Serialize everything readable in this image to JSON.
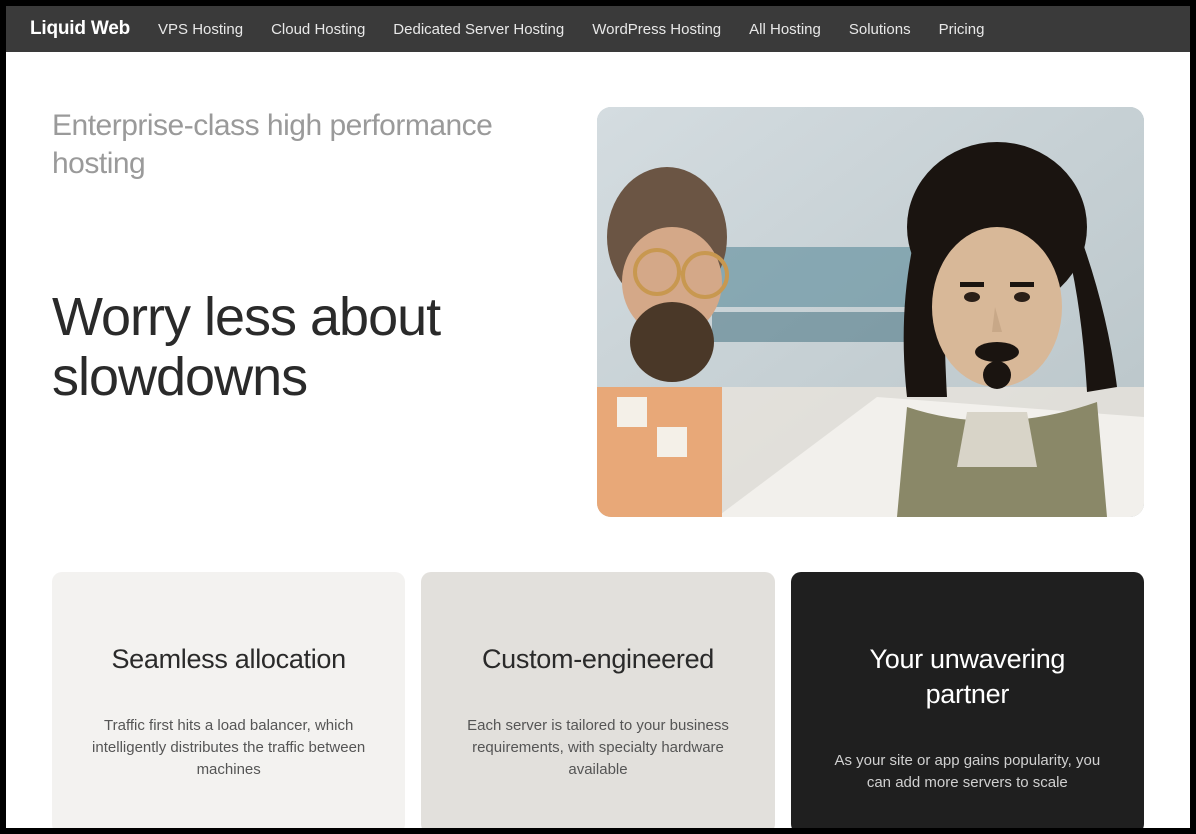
{
  "nav": {
    "brand": "Liquid Web",
    "links": [
      "VPS Hosting",
      "Cloud Hosting",
      "Dedicated Server Hosting",
      "WordPress Hosting",
      "All Hosting",
      "Solutions",
      "Pricing"
    ]
  },
  "hero": {
    "subtitle": "Enterprise-class high performance hosting",
    "title": "Worry less about slowdowns"
  },
  "cards": [
    {
      "title": "Seamless allocation",
      "desc": "Traffic first hits a load balancer, which intelligently distributes the traffic between machines"
    },
    {
      "title": "Custom-engineered",
      "desc": "Each server is tailored to your business requirements, with specialty hardware available"
    },
    {
      "title": "Your unwavering partner",
      "desc": "As your site or app gains popularity, you can add more servers to scale"
    }
  ]
}
